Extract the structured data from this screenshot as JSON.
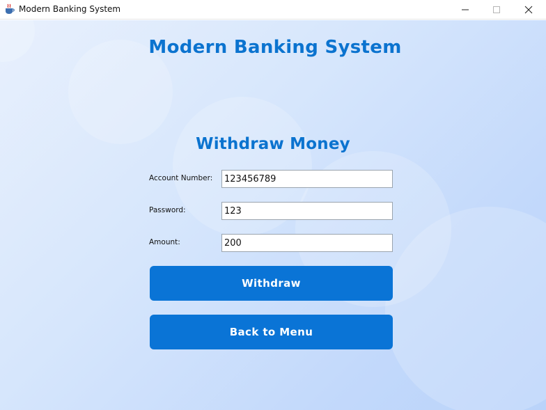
{
  "window": {
    "title": "Modern Banking System",
    "controls": {
      "minimize": "—",
      "maximize": "☐",
      "close": "✕"
    },
    "app_icon": "java-coffee-cup-icon"
  },
  "page": {
    "app_title": "Modern Banking System",
    "section_title": "Withdraw Money"
  },
  "form": {
    "account_label": "Account Number:",
    "account_value": "123456789",
    "password_label": "Password:",
    "password_value": "123",
    "amount_label": "Amount:",
    "amount_value": "200"
  },
  "buttons": {
    "withdraw_label": "Withdraw",
    "back_label": "Back to Menu"
  },
  "colors": {
    "accent": "#0B73CF",
    "button": "#0A74D6",
    "background": "#C9DDFB"
  }
}
